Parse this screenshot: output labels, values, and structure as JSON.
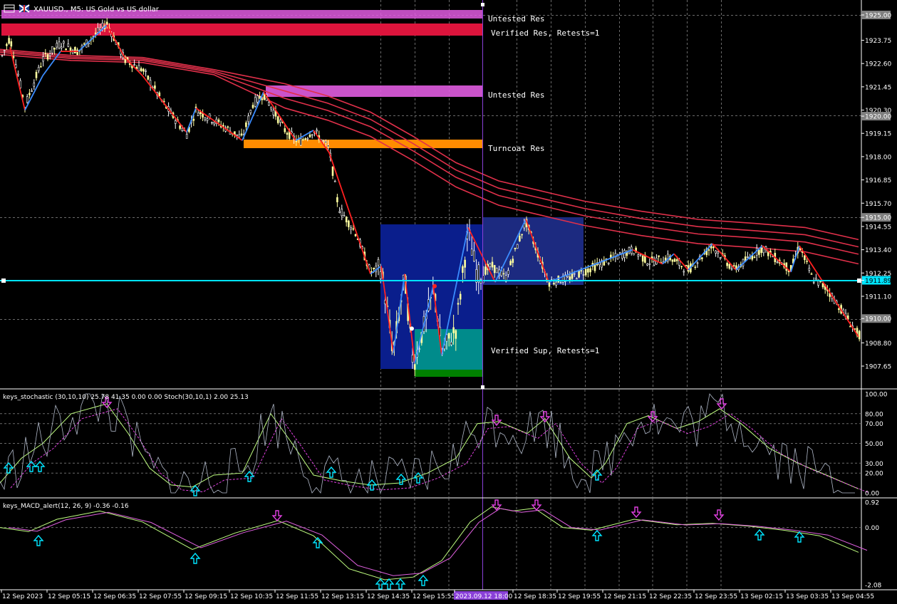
{
  "window": {
    "title": "XAUUSD., M5:  US Gold vs US dollar"
  },
  "colors": {
    "background": "#000000",
    "bull_candle": "#ffffff",
    "bear_candle": "#ffffa0",
    "zigzag_up": "#3b8cff",
    "zigzag_down": "#ff2020",
    "ma_ribbon": "#e0304a",
    "current_price_line": "#00e5ff",
    "untested_res": "#e05ce0",
    "verified_res": "#dc143c",
    "turncoat_res": "#ff8c00",
    "verified_sup": "#008b8b",
    "verified_sup_edge": "#008000",
    "dark_box": "#0a1e8c",
    "stoch_main": "#b0b8c8",
    "stoch_signal": "#c0ff80",
    "stoch_dash": "#e040e0",
    "macd_main": "#c0ff80",
    "macd_signal": "#e060e0",
    "arrow_up": "#00e5ff",
    "arrow_down": "#e040e0"
  },
  "price_axis": {
    "labels": [
      "1925.00",
      "1923.75",
      "1922.60",
      "1921.45",
      "1920.30",
      "1920.00",
      "1919.15",
      "1918.00",
      "1916.85",
      "1915.70",
      "1915.00",
      "1914.55",
      "1913.40",
      "1912.25",
      "1911.89",
      "1911.10",
      "1910.00",
      "1908.80",
      "1907.65"
    ],
    "highlighted": [
      "1925.00",
      "1920.00",
      "1915.00",
      "1910.00"
    ],
    "current_price": "1911.89"
  },
  "zones": {
    "untested_res_top": "Untested Res",
    "verified_res": "Verified Res, Retests=1",
    "untested_res_mid": "Untested Res",
    "turncoat_res": "Turncoat Res",
    "verified_sup": "Verified Sup, Retests=1"
  },
  "stochastic": {
    "title": "keys_stochastic (30,10,10) 25.78 41.35 0.00 0.00 Stoch(30,10,1) 2.00 25.13",
    "levels": [
      "100.00",
      "80.00",
      "70.00",
      "50.00",
      "30.00",
      "20.00",
      "0.00"
    ]
  },
  "macd": {
    "title": "keys_MACD_alert(12, 26, 9) -0.36 -0.16",
    "levels": [
      "0.92",
      "0.00",
      "-2.08"
    ]
  },
  "time_axis": {
    "labels": [
      "12 Sep 2023",
      "12 Sep 05:15",
      "12 Sep 06:35",
      "12 Sep 07:55",
      "12 Sep 09:15",
      "12 Sep 10:35",
      "12 Sep 11:55",
      "12 Sep 13:15",
      "12 Sep 14:35",
      "12 Sep 15:55",
      "2023.09.12 18:00",
      "12 Sep 18:35",
      "12 Sep 19:55",
      "12 Sep 21:15",
      "12 Sep 22:35",
      "12 Sep 23:55",
      "13 Sep 02:15",
      "13 Sep 03:35",
      "13 Sep 04:55"
    ],
    "highlighted": "2023.09.12 18:00"
  }
}
